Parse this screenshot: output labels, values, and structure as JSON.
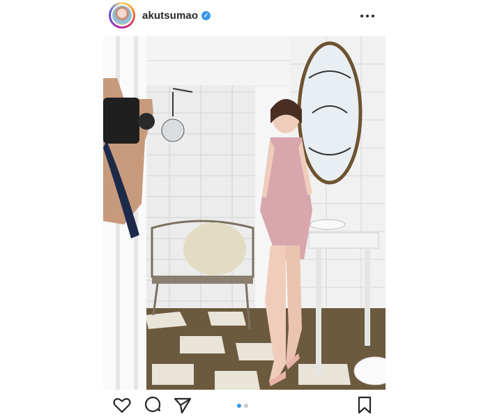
{
  "header": {
    "username": "akutsumao",
    "verified": true
  },
  "photo": {
    "description_icon": "image",
    "carousel": {
      "count": 2,
      "active_index": 0
    }
  },
  "actions": {
    "like_icon": "heart-icon",
    "comment_icon": "comment-icon",
    "share_icon": "share-icon",
    "save_icon": "bookmark-icon"
  },
  "colors": {
    "accent": "#3897f0",
    "text": "#262626",
    "inactive_dot": "#c7c7c7"
  }
}
